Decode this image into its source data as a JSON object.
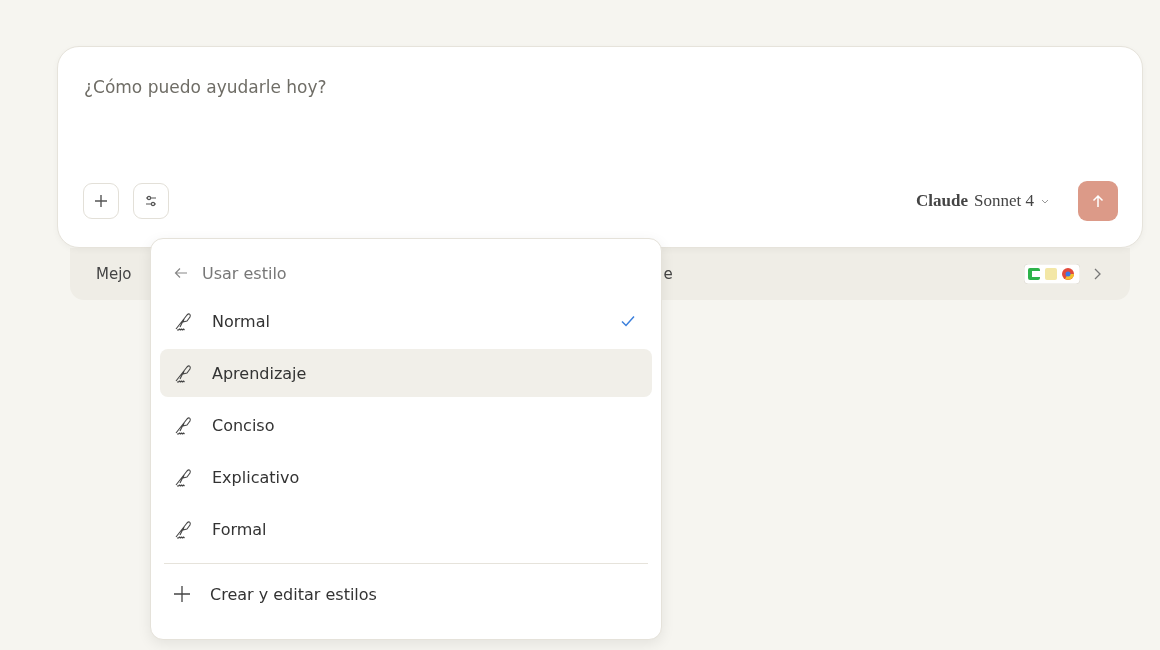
{
  "composer": {
    "placeholder": "¿Cómo puedo ayudarle hoy?",
    "model": {
      "brand": "Claude",
      "name": "Sonnet 4"
    }
  },
  "strip": {
    "text_start": "Mejo",
    "text_end": "e"
  },
  "style_menu": {
    "header": "Usar estilo",
    "items": [
      {
        "label": "Normal",
        "selected": true,
        "highlighted": false
      },
      {
        "label": "Aprendizaje",
        "selected": false,
        "highlighted": true
      },
      {
        "label": "Conciso",
        "selected": false,
        "highlighted": false
      },
      {
        "label": "Explicativo",
        "selected": false,
        "highlighted": false
      },
      {
        "label": "Formal",
        "selected": false,
        "highlighted": false
      }
    ],
    "footer": "Crear y editar estilos"
  }
}
